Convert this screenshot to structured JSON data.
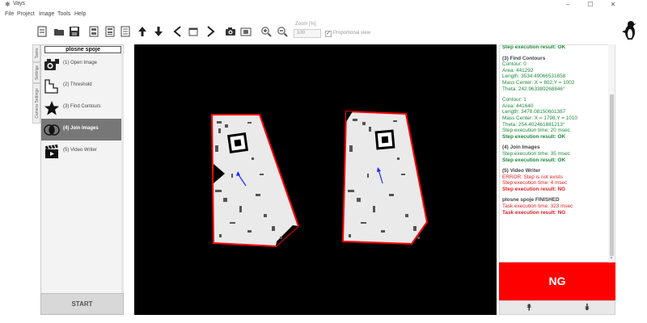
{
  "window": {
    "title": "Vays",
    "minimize": "–",
    "maximize": "☐",
    "close": "✕"
  },
  "menu": [
    "File",
    "Project",
    "Image",
    "Tools",
    "Help"
  ],
  "toolbar": {
    "buttons": [
      "new-document-icon",
      "open-folder-icon",
      "save-icon",
      "panel-a-icon",
      "panel-b-icon",
      "panel-c-icon",
      "arrow-up-icon",
      "arrow-down-icon",
      "arrow-left-icon",
      "window-icon",
      "arrow-right-icon",
      "camera-icon",
      "frame-icon",
      "zoom-in-icon",
      "zoom-out-icon"
    ],
    "zoom_label": "Zoom [%]",
    "zoom_value": "100",
    "proportional_label": "Proportional view",
    "proportional_checked": true
  },
  "left_tabs": [
    "Tasks",
    "Settings",
    "Camera Settings"
  ],
  "task": {
    "title": "plosne spoje",
    "steps": [
      {
        "label": "(1) Open Image",
        "icon": "camera-icon",
        "active": false
      },
      {
        "label": "(2) Threshold",
        "icon": "staircase-icon",
        "active": false
      },
      {
        "label": "(3) Find Contours",
        "icon": "star-icon",
        "active": false
      },
      {
        "label": "(4) Join Images",
        "icon": "overlap-circles-icon",
        "active": true
      },
      {
        "label": "(5) Video Writer",
        "icon": "film-clapper-icon",
        "active": false
      }
    ],
    "start_label": "START"
  },
  "log": {
    "lines": [
      {
        "text": "Step execution result: OK",
        "style": "green bold"
      },
      {
        "text": "",
        "style": "gap"
      },
      {
        "text": "(3) Find Contours",
        "style": "title"
      },
      {
        "text": "Contour: 0",
        "style": "green"
      },
      {
        "text": "Area: 441292",
        "style": "green"
      },
      {
        "text": "Length: 3534.49066531658",
        "style": "green"
      },
      {
        "text": "Mass Center: X = 802,Y = 1002",
        "style": "green"
      },
      {
        "text": "Theta: 242.963389268846°",
        "style": "green"
      },
      {
        "text": "",
        "style": "gap"
      },
      {
        "text": "Contour: 1",
        "style": "green"
      },
      {
        "text": "Area: 441640",
        "style": "green"
      },
      {
        "text": "Length: 3478.08150601387",
        "style": "green"
      },
      {
        "text": "Mass Center: X = 1798,Y = 1010",
        "style": "green"
      },
      {
        "text": "Theta: 254.402461881213°",
        "style": "green"
      },
      {
        "text": "Step execution time: 20 msec",
        "style": "green"
      },
      {
        "text": "Step execution result: OK",
        "style": "green bold"
      },
      {
        "text": "",
        "style": "gap"
      },
      {
        "text": "(4) Join Images",
        "style": "title"
      },
      {
        "text": "Step execution time: 35 msec",
        "style": "green"
      },
      {
        "text": "Step execution result: OK",
        "style": "green bold"
      },
      {
        "text": "",
        "style": "gap"
      },
      {
        "text": "(5) Video Writer",
        "style": "title"
      },
      {
        "text": "ERROR: Step is not exists",
        "style": "red"
      },
      {
        "text": "Step execution time: 4 msec",
        "style": "red"
      },
      {
        "text": "Step execution result: NG",
        "style": "red bold"
      },
      {
        "text": "",
        "style": "gap"
      },
      {
        "text": "plosne spoje FINISHED",
        "style": "title"
      },
      {
        "text": "Task execution time: 323 msec",
        "style": "red"
      },
      {
        "text": "Task execution result: NG",
        "style": "red bold"
      }
    ]
  },
  "result": {
    "text": "NG",
    "color": "#ff0000"
  },
  "nav": {
    "up": "⯭",
    "down": "⯯"
  },
  "colors": {
    "ok_green": "#1d8a3a",
    "error_red": "#e02020",
    "contour_red": "#ff0000",
    "active_step": "#777777"
  }
}
